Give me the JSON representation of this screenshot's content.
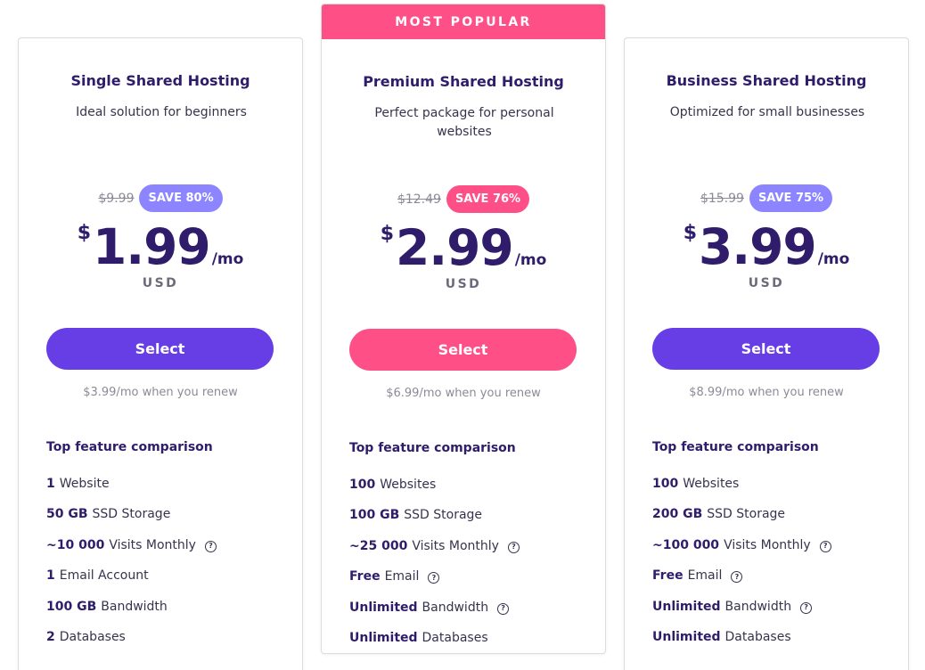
{
  "badge": "MOST POPULAR",
  "plans": [
    {
      "title": "Single Shared Hosting",
      "description": "Ideal solution for beginners",
      "old_price": "$9.99",
      "save": "SAVE 80%",
      "currency_symbol": "$",
      "price": "1.99",
      "period": "/mo",
      "currency_code": "USD",
      "select_label": "Select",
      "renew": "$3.99/mo when you renew",
      "features_heading": "Top feature comparison",
      "features": [
        {
          "bold": "1",
          "text": "Website",
          "help": false
        },
        {
          "bold": "50 GB",
          "text": "SSD Storage",
          "help": false
        },
        {
          "bold": "~10 000",
          "text": "Visits Monthly",
          "help": true
        },
        {
          "bold": "1",
          "text": "Email Account",
          "help": false
        },
        {
          "bold": "100 GB",
          "text": "Bandwidth",
          "help": false
        },
        {
          "bold": "2",
          "text": "Databases",
          "help": false
        }
      ]
    },
    {
      "title": "Premium Shared Hosting",
      "description": "Perfect package for personal websites",
      "old_price": "$12.49",
      "save": "SAVE 76%",
      "currency_symbol": "$",
      "price": "2.99",
      "period": "/mo",
      "currency_code": "USD",
      "select_label": "Select",
      "renew": "$6.99/mo when you renew",
      "features_heading": "Top feature comparison",
      "features": [
        {
          "bold": "100",
          "text": "Websites",
          "help": false
        },
        {
          "bold": "100 GB",
          "text": "SSD Storage",
          "help": false
        },
        {
          "bold": "~25 000",
          "text": "Visits Monthly",
          "help": true
        },
        {
          "bold": "Free",
          "text": "Email",
          "help": true
        },
        {
          "bold": "Unlimited",
          "text": "Bandwidth",
          "help": true
        },
        {
          "bold": "Unlimited",
          "text": "Databases",
          "help": false
        }
      ]
    },
    {
      "title": "Business Shared Hosting",
      "description": "Optimized for small businesses",
      "old_price": "$15.99",
      "save": "SAVE 75%",
      "currency_symbol": "$",
      "price": "3.99",
      "period": "/mo",
      "currency_code": "USD",
      "select_label": "Select",
      "renew": "$8.99/mo when you renew",
      "features_heading": "Top feature comparison",
      "features": [
        {
          "bold": "100",
          "text": "Websites",
          "help": false
        },
        {
          "bold": "200 GB",
          "text": "SSD Storage",
          "help": false
        },
        {
          "bold": "~100 000",
          "text": "Visits Monthly",
          "help": true
        },
        {
          "bold": "Free",
          "text": "Email",
          "help": true
        },
        {
          "bold": "Unlimited",
          "text": "Bandwidth",
          "help": true
        },
        {
          "bold": "Unlimited",
          "text": "Databases",
          "help": false
        }
      ]
    }
  ],
  "colors": {
    "primary": "#673de6",
    "accent": "#ff4f87",
    "save_badge": "#8c85ff",
    "text_dark": "#2f1c6a"
  },
  "icons": {
    "help": "question-circle-icon"
  }
}
